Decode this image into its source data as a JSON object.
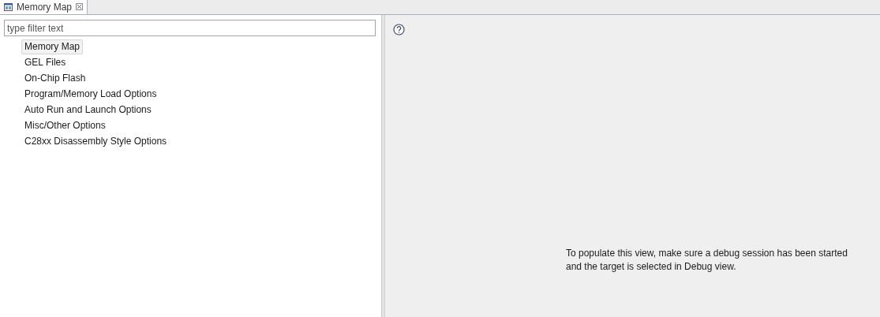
{
  "tab": {
    "title": "Memory Map",
    "selected": true
  },
  "filter": {
    "placeholder": "type filter text"
  },
  "pages": [
    {
      "label": "Memory Map",
      "selected": true
    },
    {
      "label": "GEL Files",
      "selected": false
    },
    {
      "label": "On-Chip Flash",
      "selected": false
    },
    {
      "label": "Program/Memory Load Options",
      "selected": false
    },
    {
      "label": "Auto Run and Launch Options",
      "selected": false
    },
    {
      "label": "Misc/Other Options",
      "selected": false
    },
    {
      "label": "C28xx Disassembly Style Options",
      "selected": false
    }
  ],
  "message": "To populate this view, make sure a debug session has been started and the target is selected in Debug view."
}
